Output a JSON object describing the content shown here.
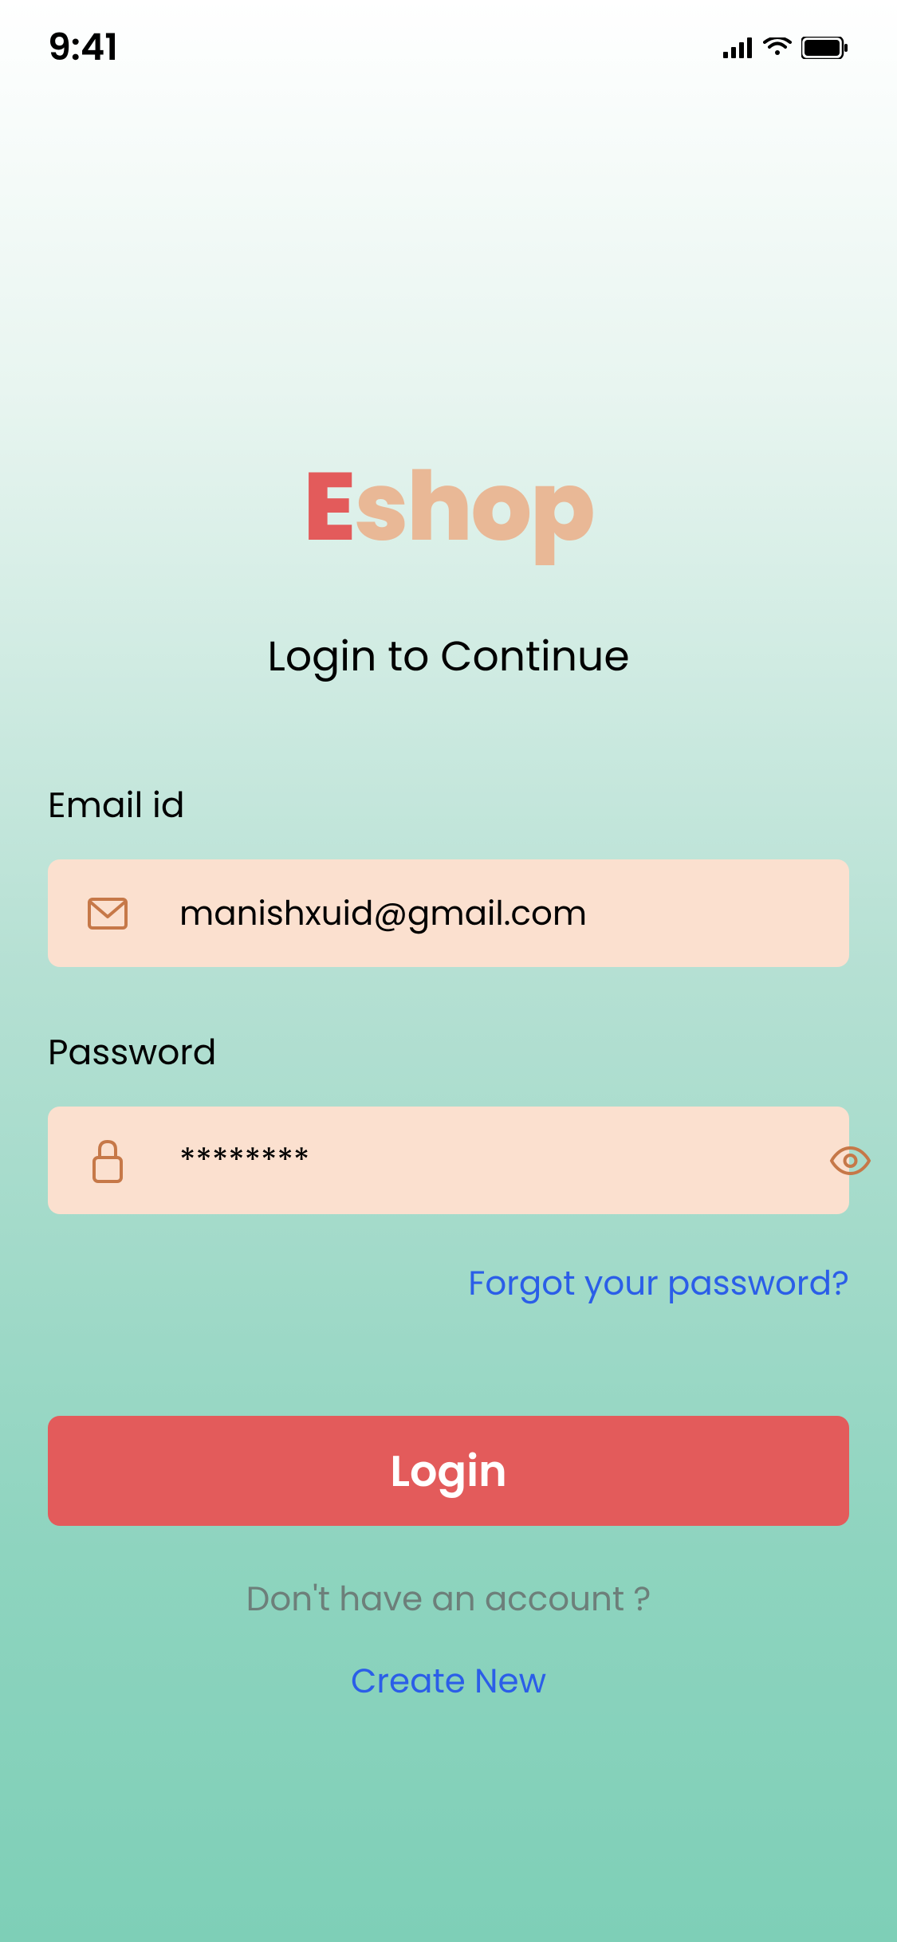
{
  "statusBar": {
    "time": "9:41"
  },
  "logo": {
    "part1": "E",
    "part2": "shop"
  },
  "subtitle": "Login to Continue",
  "emailField": {
    "label": "Email id",
    "value": "manishxuid@gmail.com"
  },
  "passwordField": {
    "label": "Password",
    "value": "********"
  },
  "links": {
    "forgot": "Forgot your password?",
    "login": "Login",
    "noAccount": "Don't have an account ?",
    "createNew": "Create New"
  }
}
